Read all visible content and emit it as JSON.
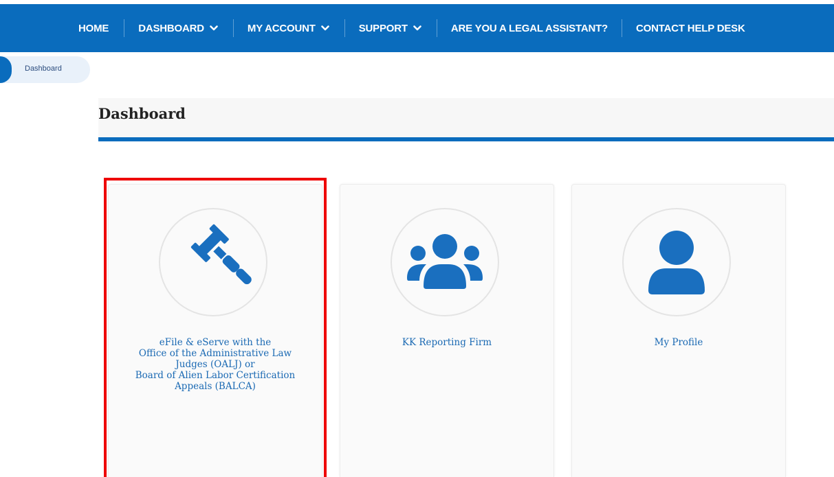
{
  "nav": {
    "items": [
      {
        "label": "HOME",
        "dropdown": false
      },
      {
        "label": "DASHBOARD",
        "dropdown": true
      },
      {
        "label": "MY ACCOUNT",
        "dropdown": true
      },
      {
        "label": "SUPPORT",
        "dropdown": true
      },
      {
        "label": "ARE YOU A LEGAL ASSISTANT?",
        "dropdown": false
      },
      {
        "label": "CONTACT HELP DESK",
        "dropdown": false
      }
    ]
  },
  "breadcrumb": {
    "label": "Dashboard"
  },
  "page": {
    "title": "Dashboard"
  },
  "cards": [
    {
      "icon": "gavel-icon",
      "lines": [
        "eFile & eServe with the",
        "Office of the Administrative Law",
        "Judges (OALJ) or",
        "Board of Alien Labor Certification",
        "Appeals (BALCA)"
      ],
      "highlighted": true
    },
    {
      "icon": "users-icon",
      "lines": [
        "KK Reporting Firm"
      ],
      "highlighted": false
    },
    {
      "icon": "user-icon",
      "lines": [
        "My Profile"
      ],
      "highlighted": false
    }
  ],
  "colors": {
    "brand": "#0a6cbd",
    "link": "#1a69b3",
    "highlight": "#ee0000"
  }
}
